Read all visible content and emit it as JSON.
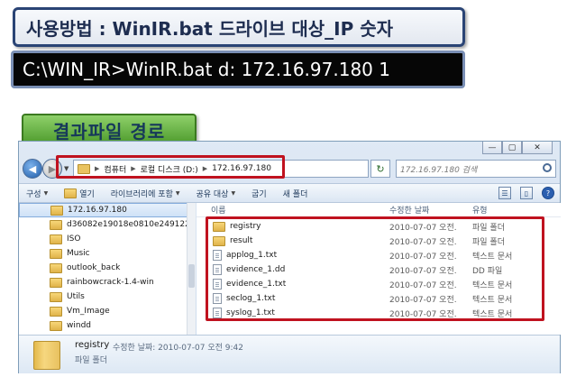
{
  "banners": {
    "usage": "사용방법 : WinIR.bat 드라이브 대상_IP 숫자",
    "command": "C:\\WIN_IR>WinIR.bat d: 172.16.97.180 1",
    "section_label": "결과파일 경로"
  },
  "window": {
    "controls": [
      "—",
      "▢",
      "✕"
    ]
  },
  "address": {
    "crumbs": [
      "컴퓨터",
      "로컬 디스크 (D:)",
      "172.16.97.180"
    ],
    "search_placeholder": "172.16.97.180 검색"
  },
  "toolbar": {
    "organize": "구성",
    "open": "열기",
    "include_library": "라이브러리에 포함",
    "share": "공유 대상",
    "burn": "굽기",
    "new_folder": "새 폴더"
  },
  "nav_pane": {
    "items": [
      "172.16.97.180",
      "d36082e19018e0810e249122",
      "ISO",
      "Music",
      "outlook_back",
      "rainbowcrack-1.4-win",
      "Utils",
      "Vm_Image",
      "windd"
    ]
  },
  "file_list": {
    "headers": {
      "name": "이름",
      "date": "수정한 날짜",
      "type": "유형"
    },
    "rows": [
      {
        "name": "registry",
        "date": "2010-07-07 오전...",
        "type": "파일 폴더",
        "kind": "folder"
      },
      {
        "name": "result",
        "date": "2010-07-07 오전...",
        "type": "파일 폴더",
        "kind": "folder"
      },
      {
        "name": "applog_1.txt",
        "date": "2010-07-07 오전...",
        "type": "텍스트 문서",
        "kind": "file"
      },
      {
        "name": "evidence_1.dd",
        "date": "2010-07-07 오전...",
        "type": "DD 파일",
        "kind": "file"
      },
      {
        "name": "evidence_1.txt",
        "date": "2010-07-07 오전...",
        "type": "텍스트 문서",
        "kind": "file"
      },
      {
        "name": "seclog_1.txt",
        "date": "2010-07-07 오전...",
        "type": "텍스트 문서",
        "kind": "file"
      },
      {
        "name": "syslog_1.txt",
        "date": "2010-07-07 오전...",
        "type": "텍스트 문서",
        "kind": "file"
      }
    ]
  },
  "details": {
    "name": "registry",
    "modified_label": "수정한 날짜: 2010-07-07 오전 9:42",
    "type": "파일 폴더"
  },
  "colors": {
    "annotation_red": "#c0121f",
    "banner_border": "#2a4475",
    "label_green": "#4d9a2b"
  },
  "icons": {
    "back": "back-arrow-icon",
    "refresh": "refresh-icon",
    "search": "search-icon",
    "folder": "folder-icon",
    "document": "document-icon",
    "help": "help-icon"
  }
}
